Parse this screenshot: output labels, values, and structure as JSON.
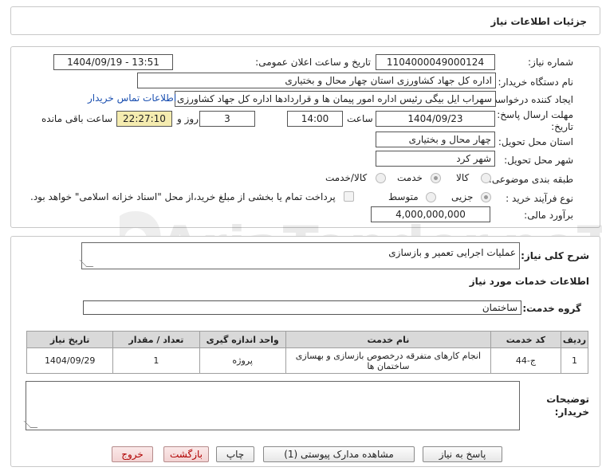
{
  "page_title": "جزئیات اطلاعات نیاز",
  "watermark": "AriaTender.neT",
  "form": {
    "need_number_label": "شماره نیاز:",
    "need_number": "1104000049000124",
    "announce_label": "تاریخ و ساعت اعلان عمومی:",
    "announce_value": "1404/09/19 - 13:51",
    "buyer_label": "نام دستگاه خریدار:",
    "buyer_value": "اداره کل جهاد کشاورزی استان چهار محال و بختیاری",
    "creator_label": "ایجاد کننده درخواست:",
    "creator_value": "سهراب ایل بیگی رئیس اداره امور پیمان ها و قراردادها اداره کل جهاد کشاورزی ا",
    "contact_link": "اطلاعات تماس خریدار",
    "deadline_label_1": "مهلت ارسال پاسخ: تا",
    "deadline_label_2": "تاریخ:",
    "deadline_date": "1404/09/23",
    "time_label": "ساعت",
    "deadline_time": "14:00",
    "days_value": "3",
    "days_label": "روز و",
    "remaining_time": "22:27:10",
    "remaining_label": "ساعت باقی مانده",
    "province_label": "استان محل تحویل:",
    "province_value": "چهار محال و بختیاری",
    "city_label": "شهر محل تحویل:",
    "city_value": "شهر کرد",
    "category_label": "طبقه بندی موضوعی:",
    "category_options": [
      "کالا",
      "خدمت",
      "کالا/خدمت"
    ],
    "category_selected": 1,
    "process_label": "نوع فرآیند خرید :",
    "process_options": [
      "جزیی",
      "متوسط"
    ],
    "process_selected": 0,
    "payment_note": "پرداخت تمام یا بخشی از مبلغ خرید،از محل \"اسناد خزانه اسلامی\" خواهد بود.",
    "budget_label": "برآورد مالی:",
    "budget_value": "4,000,000,000"
  },
  "summary": {
    "label": "شرح کلی نیاز:",
    "value": "عملیات اجرایی تعمیر و بازسازی"
  },
  "services": {
    "heading": "اطلاعات خدمات مورد نیاز",
    "group_label": "گروه خدمت:",
    "group_value": "ساختمان",
    "columns": [
      "ردیف",
      "کد خدمت",
      "نام خدمت",
      "واحد اندازه گیری",
      "تعداد / مقدار",
      "تاریخ نیاز"
    ],
    "rows": [
      [
        "1",
        "ج-44",
        "انجام کارهای متفرقه درخصوص بازسازی و بهسازی ساختمان ها",
        "پروژه",
        "1",
        "1404/09/29"
      ]
    ]
  },
  "buyer_notes": {
    "label_1": "توضیحات",
    "label_2": "خریدار:",
    "value": ""
  },
  "buttons": {
    "reply": "پاسخ به نیاز",
    "attachments": "مشاهده مدارک پیوستی (1)",
    "print": "چاپ",
    "back": "بازگشت",
    "exit": "خروج"
  }
}
